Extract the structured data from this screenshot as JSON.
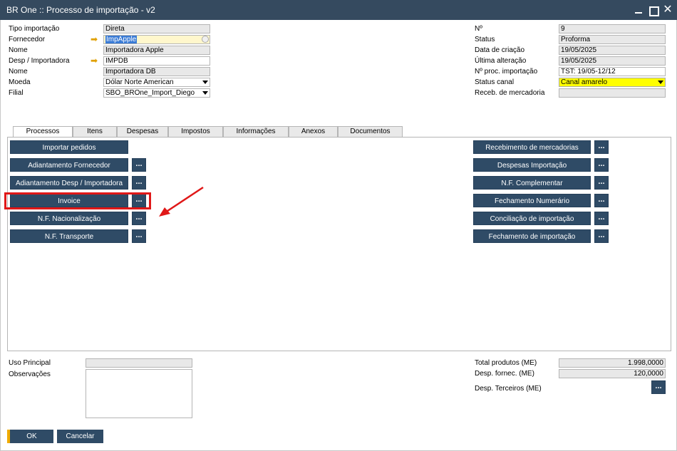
{
  "window": {
    "title": "BR One :: Processo de importação - v2"
  },
  "header_left": {
    "tipo_importacao_label": "Tipo importação",
    "tipo_importacao_value": "Direta",
    "fornecedor_label": "Fornecedor",
    "fornecedor_value": "ImpApple",
    "nome1_label": "Nome",
    "nome1_value": "Importadora Apple",
    "desp_importadora_label": "Desp / Importadora",
    "desp_importadora_value": "IMPDB",
    "nome2_label": "Nome",
    "nome2_value": "Importadora DB",
    "moeda_label": "Moeda",
    "moeda_value": "Dólar Norte American",
    "filial_label": "Filial",
    "filial_value": "SBO_BROne_Import_Diego"
  },
  "header_right": {
    "numero_label": "Nº",
    "numero_value": "9",
    "status_label": "Status",
    "status_value": "Proforma",
    "data_criacao_label": "Data de criação",
    "data_criacao_value": "19/05/2025",
    "ultima_alteracao_label": "Última alteração",
    "ultima_alteracao_value": "19/05/2025",
    "proc_importacao_label": "Nº proc. importação",
    "proc_importacao_value": "TST: 19/05-12/12",
    "status_canal_label": "Status canal",
    "status_canal_value": "Canal amarelo",
    "receb_mercadoria_label": "Receb. de mercadoria",
    "receb_mercadoria_value": ""
  },
  "tabs": [
    "Processos",
    "Itens",
    "Despesas",
    "Impostos",
    "Informações",
    "Anexos",
    "Documentos"
  ],
  "processos": {
    "left_buttons": [
      "Importar pedidos",
      "Adiantamento Fornecedor",
      "Adiantamento Desp / Importadora",
      "Invoice",
      "N.F. Nacionalização",
      "N.F. Transporte"
    ],
    "right_buttons": [
      "Recebimento de mercadorias",
      "Despesas Importação",
      "N.F. Complementar",
      "Fechamento Numerário",
      "Conciliação de importação",
      "Fechamento de importação"
    ],
    "dots": "..."
  },
  "footer": {
    "uso_principal_label": "Uso Principal",
    "observacoes_label": "Observações",
    "total_produtos_label": "Total produtos (ME)",
    "total_produtos_value": "1.998,0000",
    "desp_fornec_label": "Desp. fornec. (ME)",
    "desp_fornec_value": "120,0000",
    "desp_terceiros_label": "Desp. Terceiros (ME)"
  },
  "actions": {
    "ok": "OK",
    "cancel": "Cancelar"
  },
  "colors": {
    "titlebar": "#354a5f",
    "button": "#2f4b66",
    "highlight": "#e01818",
    "canal": "#ffff00",
    "ok_accent": "#f0ab00"
  }
}
